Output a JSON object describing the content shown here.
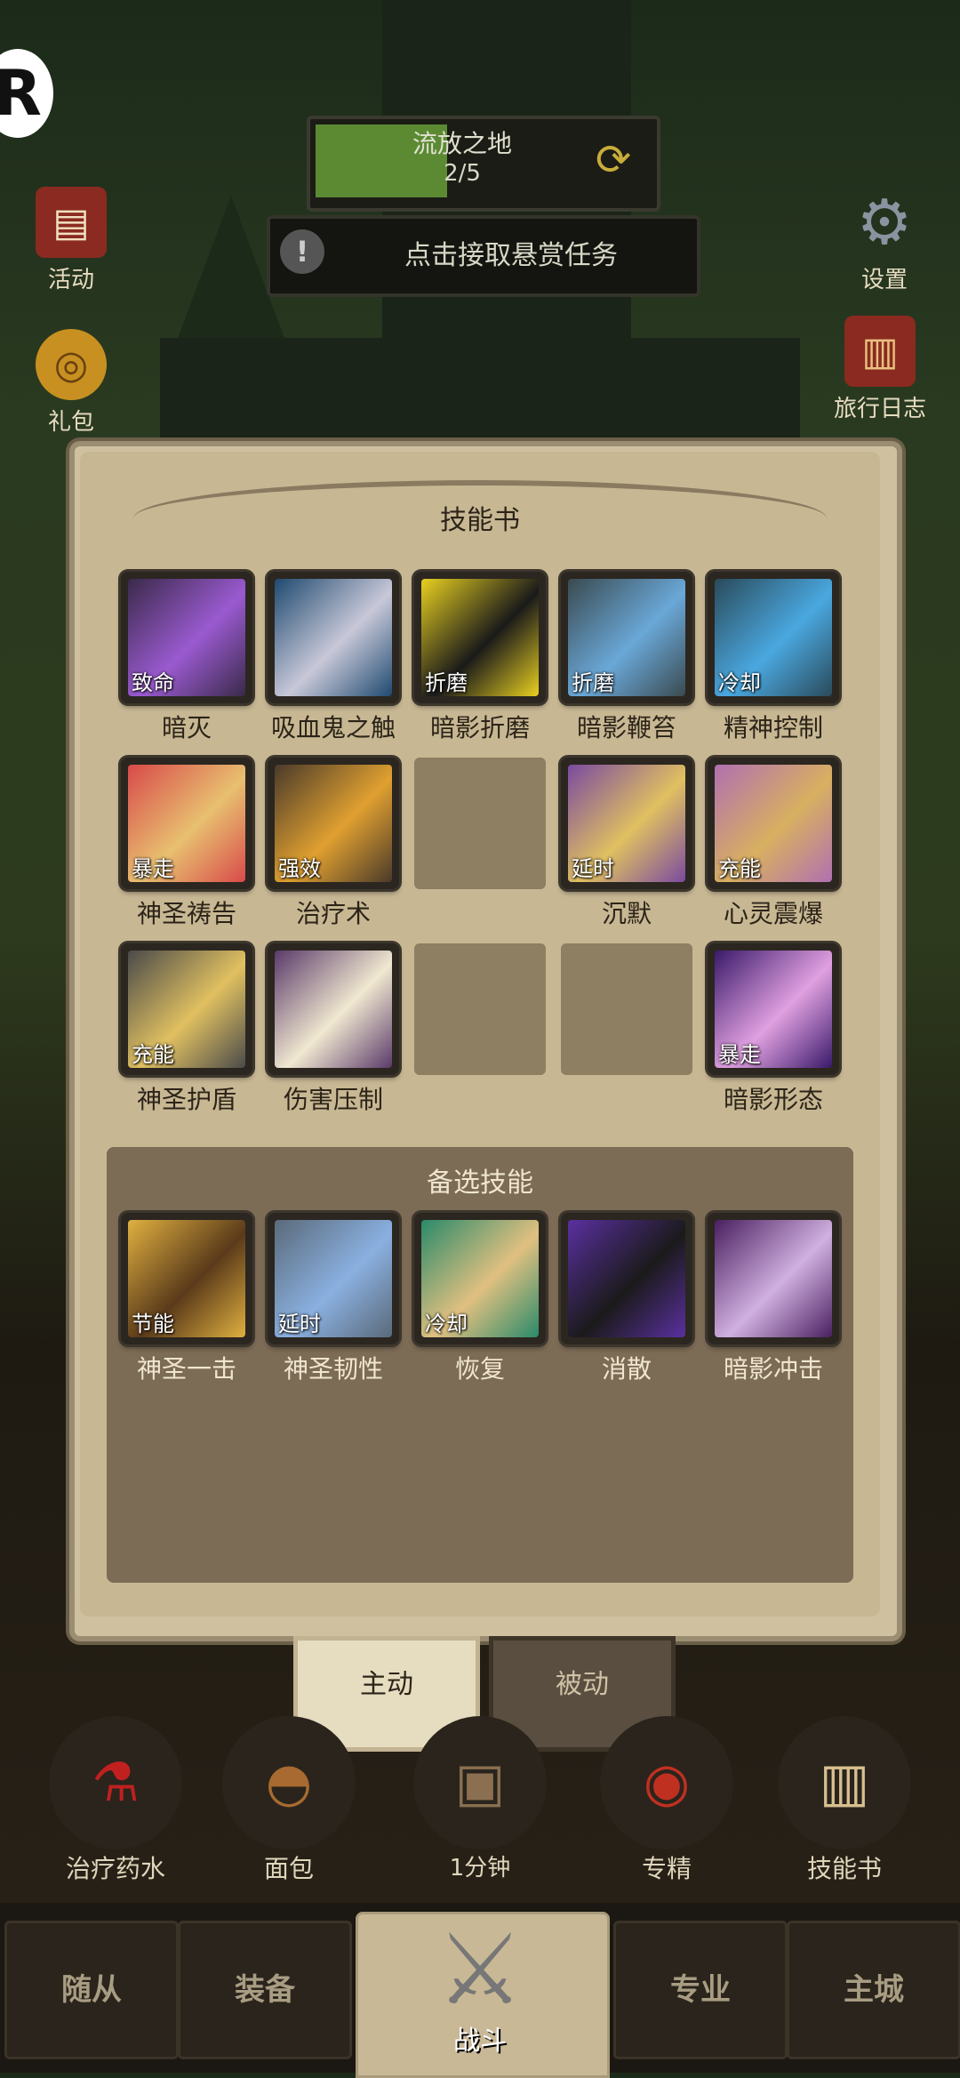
{
  "hud": {
    "region": "流放之地",
    "region_progress": "2/5",
    "region_progress_value": 0.4,
    "bounty": "点击接取悬赏任务",
    "bounty_icon": "exclamation-icon"
  },
  "left_side": [
    {
      "label": "活动",
      "icon": "scroll-icon"
    },
    {
      "label": "礼包",
      "icon": "coin-icon"
    }
  ],
  "right_side": [
    {
      "label": "设置",
      "icon": "gear-icon"
    },
    {
      "label": "旅行日志",
      "icon": "book-icon"
    }
  ],
  "dialog": {
    "title": "技能书",
    "slots": [
      {
        "name": "暗灭",
        "tag": "致命",
        "colors": [
          "#3a2a4a",
          "#9a5ad0"
        ]
      },
      {
        "name": "吸血鬼之触",
        "tag": "",
        "colors": [
          "#1f4a70",
          "#c8c8d8"
        ]
      },
      {
        "name": "暗影折磨",
        "tag": "折磨",
        "colors": [
          "#e8d020",
          "#1a1a1a"
        ]
      },
      {
        "name": "暗影鞭笞",
        "tag": "折磨",
        "colors": [
          "#3a4a50",
          "#6aa8d8"
        ]
      },
      {
        "name": "精神控制",
        "tag": "冷却",
        "colors": [
          "#2a4a5a",
          "#4aa8e0"
        ]
      },
      {
        "name": "神圣祷告",
        "tag": "暴走",
        "colors": [
          "#d84a4a",
          "#e8c070"
        ]
      },
      {
        "name": "治疗术",
        "tag": "强效",
        "colors": [
          "#4a3a2a",
          "#e0a030"
        ]
      },
      {
        "name": "",
        "tag": "",
        "empty": true
      },
      {
        "name": "沉默",
        "tag": "延时",
        "colors": [
          "#7a4aa0",
          "#e0c060"
        ]
      },
      {
        "name": "心灵震爆",
        "tag": "充能",
        "colors": [
          "#b070b0",
          "#d8b060"
        ]
      },
      {
        "name": "神圣护盾",
        "tag": "充能",
        "colors": [
          "#4a4a4a",
          "#e0c060"
        ]
      },
      {
        "name": "伤害压制",
        "tag": "",
        "colors": [
          "#5a3a6a",
          "#f0e8d0"
        ]
      },
      {
        "name": "",
        "tag": "",
        "empty": true
      },
      {
        "name": "",
        "tag": "",
        "empty": true
      },
      {
        "name": "暗影形态",
        "tag": "暴走",
        "colors": [
          "#3a1a6a",
          "#e0a0e0"
        ]
      }
    ],
    "reserve_title": "备选技能",
    "reserve": [
      {
        "name": "神圣一击",
        "tag": "节能",
        "colors": [
          "#e0b040",
          "#5a3a1a"
        ]
      },
      {
        "name": "神圣韧性",
        "tag": "延时",
        "colors": [
          "#5a6a7a",
          "#8ab0e0"
        ]
      },
      {
        "name": "恢复",
        "tag": "冷却",
        "colors": [
          "#2a8a6a",
          "#e0c080"
        ]
      },
      {
        "name": "消散",
        "tag": "",
        "colors": [
          "#5a30a0",
          "#1a1a1a"
        ]
      },
      {
        "name": "暗影冲击",
        "tag": "",
        "colors": [
          "#4a2060",
          "#d0b0e0"
        ]
      }
    ]
  },
  "tabs": {
    "active": "主动",
    "passive": "被动"
  },
  "actions": [
    {
      "label": "治疗药水",
      "icon": "potion-icon"
    },
    {
      "label": "面包",
      "icon": "bread-icon"
    },
    {
      "label": "",
      "icon": "chest-icon"
    },
    {
      "label": "专精",
      "icon": "target-icon"
    },
    {
      "label": "技能书",
      "icon": "skillbook-icon"
    }
  ],
  "chest_time": "1分钟",
  "nav": [
    "随从",
    "装备",
    "战斗",
    "专业",
    "主城"
  ]
}
